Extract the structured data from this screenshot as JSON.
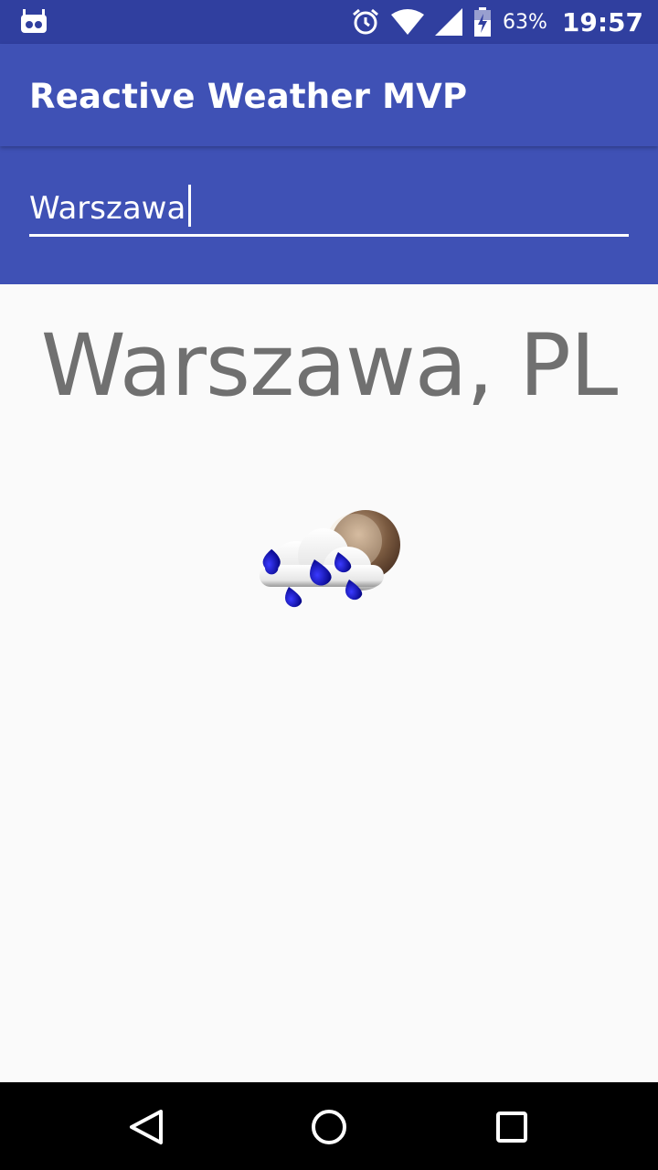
{
  "status_bar": {
    "battery_percent": "63%",
    "time": "19:57",
    "icons": [
      "android-debug-icon",
      "alarm-icon",
      "wifi-icon",
      "signal-icon",
      "battery-charging-icon"
    ]
  },
  "app_bar": {
    "title": "Reactive Weather MVP"
  },
  "search": {
    "value": "Warszawa"
  },
  "weather": {
    "location": "Warszawa, PL",
    "condition_icon": "rain-cloud-with-moon-icon"
  },
  "nav_bar": {
    "icons": [
      "back-icon",
      "home-icon",
      "recents-icon"
    ]
  },
  "colors": {
    "primary": "#3f51b5",
    "primary_dark": "#303f9f",
    "background": "#fafafa",
    "city_text": "#707070"
  }
}
